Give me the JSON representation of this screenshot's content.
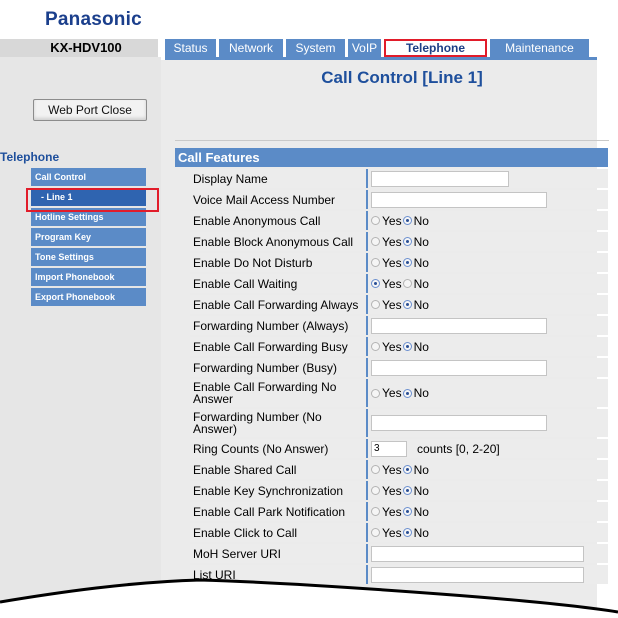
{
  "brand": "Panasonic",
  "model": "KX-HDV100",
  "tabs": [
    {
      "label": "Status"
    },
    {
      "label": "Network"
    },
    {
      "label": "System"
    },
    {
      "label": "VoIP"
    },
    {
      "label": "Telephone"
    },
    {
      "label": "Maintenance"
    }
  ],
  "web_port_close": "Web Port Close",
  "page_title": "Call Control [Line 1]",
  "nav": {
    "title": "Telephone",
    "items": [
      {
        "label": "Call Control"
      },
      {
        "label": "- Line 1"
      },
      {
        "label": "Hotline Settings"
      },
      {
        "label": "Program Key"
      },
      {
        "label": "Tone Settings"
      },
      {
        "label": "Import Phonebook"
      },
      {
        "label": "Export Phonebook"
      }
    ]
  },
  "section_title": "Call Features",
  "radio_labels": {
    "yes": "Yes",
    "no": "No"
  },
  "fields": {
    "display_name": {
      "label": "Display Name",
      "value": ""
    },
    "voice_mail": {
      "label": "Voice Mail Access Number",
      "value": ""
    },
    "anon_call": {
      "label": "Enable Anonymous Call",
      "value": "No"
    },
    "block_anon": {
      "label": "Enable Block Anonymous Call",
      "value": "No"
    },
    "dnd": {
      "label": "Enable Do Not Disturb",
      "value": "No"
    },
    "call_waiting": {
      "label": "Enable Call Waiting",
      "value": "Yes"
    },
    "fwd_always": {
      "label": "Enable Call Forwarding Always",
      "value": "No"
    },
    "fwd_num_always": {
      "label": "Forwarding Number (Always)",
      "value": ""
    },
    "fwd_busy": {
      "label": "Enable Call Forwarding Busy",
      "value": "No"
    },
    "fwd_num_busy": {
      "label": "Forwarding Number (Busy)",
      "value": ""
    },
    "fwd_noans": {
      "label": "Enable Call Forwarding No Answer",
      "value": "No"
    },
    "fwd_num_noans": {
      "label": "Forwarding Number (No Answer)",
      "value": ""
    },
    "ring_counts": {
      "label": "Ring Counts (No Answer)",
      "value": "3",
      "hint": "counts [0, 2-20]"
    },
    "shared_call": {
      "label": "Enable Shared Call",
      "value": "No"
    },
    "key_sync": {
      "label": "Enable Key Synchronization",
      "value": "No"
    },
    "park_notif": {
      "label": "Enable Call Park Notification",
      "value": "No"
    },
    "click_to_call": {
      "label": "Enable Click to Call",
      "value": "No"
    },
    "moh_uri": {
      "label": "MoH Server URI",
      "value": ""
    },
    "list_uri": {
      "label": "List URI",
      "value": ""
    }
  },
  "colors": {
    "accent": "#5b8bc7",
    "highlight": "#e11c2a",
    "title": "#1e4f9c"
  }
}
